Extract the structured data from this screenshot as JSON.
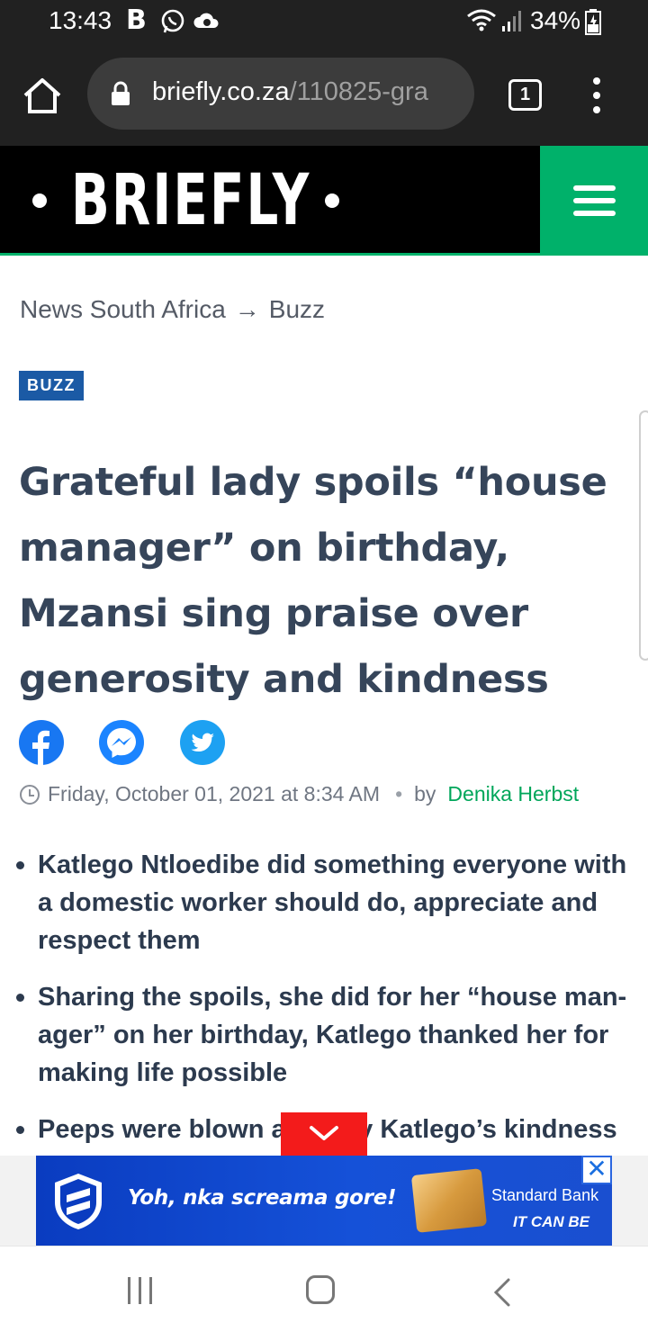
{
  "status_bar": {
    "time": "13:43",
    "app_letter": "B",
    "battery": "34%"
  },
  "browser": {
    "url_domain": "briefly.co.za",
    "url_path": "/110825-gra",
    "tab_count": "1"
  },
  "site": {
    "logo": "BRIEFLY",
    "accent_color": "#00b16a"
  },
  "breadcrumb": {
    "section": "News South Africa",
    "separator": "→",
    "category": "Buzz"
  },
  "article": {
    "badge": "BUZZ",
    "headline": "Grateful lady spoils “house manager” on birthday, Mzansi sing praise over generosity and kindness",
    "date": "Friday, October 01, 2021 at 8:34 AM",
    "by": "by",
    "author": "Denika Herbst",
    "bullets": [
      "Katlego Ntloedibe did something everyone with a domestic worker should do, appreciate and respect them",
      "Sharing the spoils, she did for her “house man­ager” on her birthday, Katlego thanked her for making life possible",
      "Peeps were blown away by Katlego’s kindness"
    ]
  },
  "ad": {
    "tagline": "Yoh, nka screama gore!",
    "brand": "Standard Bank",
    "slogan": "IT CAN BE",
    "close": "✕"
  }
}
